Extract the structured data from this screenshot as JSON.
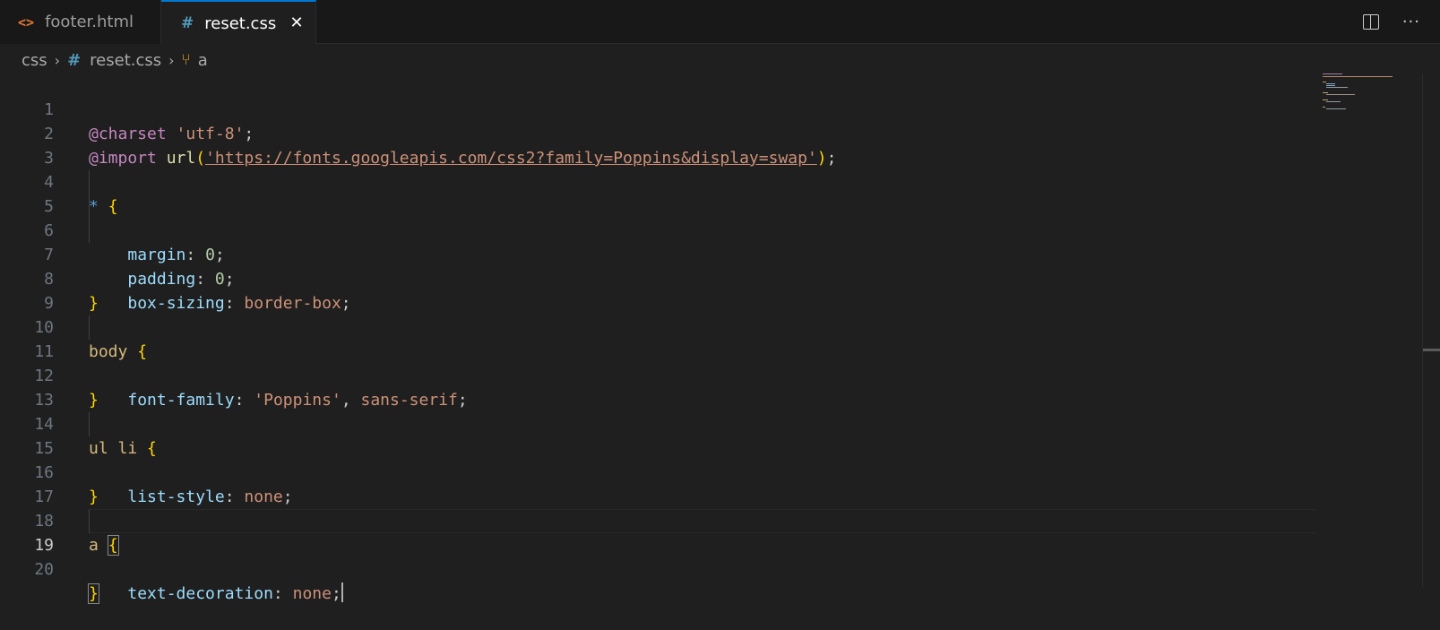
{
  "tabs": [
    {
      "label": "footer.html",
      "icon": "html-file-icon",
      "active": false
    },
    {
      "label": "reset.css",
      "icon": "css-file-icon",
      "active": true
    }
  ],
  "tab_close_glyph": "✕",
  "more_glyph": "···",
  "breadcrumb": {
    "folder": "css",
    "file": "reset.css",
    "symbol": "a"
  },
  "colors": {
    "accent": "#0078d4",
    "background": "#1f1f1f",
    "html_icon": "#e37933",
    "css_icon": "#519aba"
  },
  "editor": {
    "current_line": 19,
    "lines": [
      {
        "n": "1"
      },
      {
        "n": "2"
      },
      {
        "n": "3"
      },
      {
        "n": "4"
      },
      {
        "n": "5"
      },
      {
        "n": "6"
      },
      {
        "n": "7"
      },
      {
        "n": "8"
      },
      {
        "n": "9"
      },
      {
        "n": "10"
      },
      {
        "n": "11"
      },
      {
        "n": "12"
      },
      {
        "n": "13"
      },
      {
        "n": "14"
      },
      {
        "n": "15"
      },
      {
        "n": "16"
      },
      {
        "n": "17"
      },
      {
        "n": "18"
      },
      {
        "n": "19"
      },
      {
        "n": "20"
      }
    ],
    "tokens": {
      "l1": {
        "kw": "@charset",
        "str": "'utf-8'",
        "end": ";"
      },
      "l2": {
        "kw": "@import",
        "fn": "url",
        "open": "(",
        "url": "'https://fonts.googleapis.com/css2?family=Poppins&display=swap'",
        "close": ")",
        "end": ";"
      },
      "l4": {
        "sel": "*",
        "brace": "{"
      },
      "l5": {
        "prop": "margin",
        "colon": ": ",
        "val": "0",
        "end": ";"
      },
      "l6": {
        "prop": "padding",
        "colon": ": ",
        "val": "0",
        "end": ";"
      },
      "l7": {
        "prop": "box-sizing",
        "colon": ": ",
        "val": "border-box",
        "end": ";"
      },
      "l8": {
        "brace": "}"
      },
      "l10": {
        "sel": "body",
        "brace": "{"
      },
      "l11": {
        "prop": "font-family",
        "colon": ": ",
        "val1": "'Poppins'",
        "comma": ", ",
        "val2": "sans-serif",
        "end": ";"
      },
      "l12": {
        "brace": "}"
      },
      "l14": {
        "sel": "ul li",
        "brace": "{"
      },
      "l15": {
        "prop": "list-style",
        "colon": ": ",
        "val": "none",
        "end": ";"
      },
      "l16": {
        "brace": "}"
      },
      "l18": {
        "sel": "a",
        "brace": "{"
      },
      "l19": {
        "prop": "text-decoration",
        "colon": ": ",
        "val": "none",
        "end": ";"
      },
      "l20": {
        "brace": "}"
      }
    }
  }
}
